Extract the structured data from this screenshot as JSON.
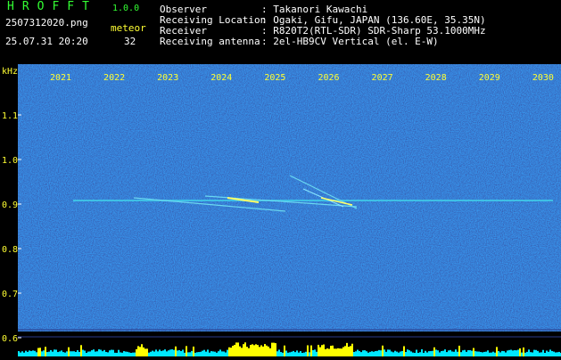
{
  "header": {
    "logo": "HROFFT",
    "version": "1.0.0",
    "filename": "2507312020.png",
    "datetime": "25.07.31 20:20",
    "meteor_label": "meteor",
    "meteor_count": "32",
    "info_labels": [
      "Observer",
      "Receiving Location",
      "Receiver",
      "Receiving antenna"
    ],
    "info_values": [
      ": Takanori Kawachi",
      ": Ogaki, Gifu, JAPAN (136.60E, 35.35N)",
      ": R820T2(RTL-SDR) SDR-Sharp 53.1000MHz",
      ": 2el-HB9CV Vertical (el. E-W)"
    ]
  },
  "spectrogram": {
    "y_unit": "kHz",
    "y_ticks": [
      "1.1",
      "1.0",
      "0.9",
      "0.8",
      "0.7",
      "0.6"
    ],
    "top_labels": [
      "2021",
      "2022",
      "2023",
      "2024",
      "2025",
      "2026",
      "2027",
      "2028",
      "2029",
      "2030"
    ],
    "colors": {
      "background": "#0a0a6e",
      "carrier": "#40c8e8",
      "panel_low": "#00e8ff",
      "panel_high": "#ffff00",
      "axis_text": "#ffff33"
    }
  }
}
